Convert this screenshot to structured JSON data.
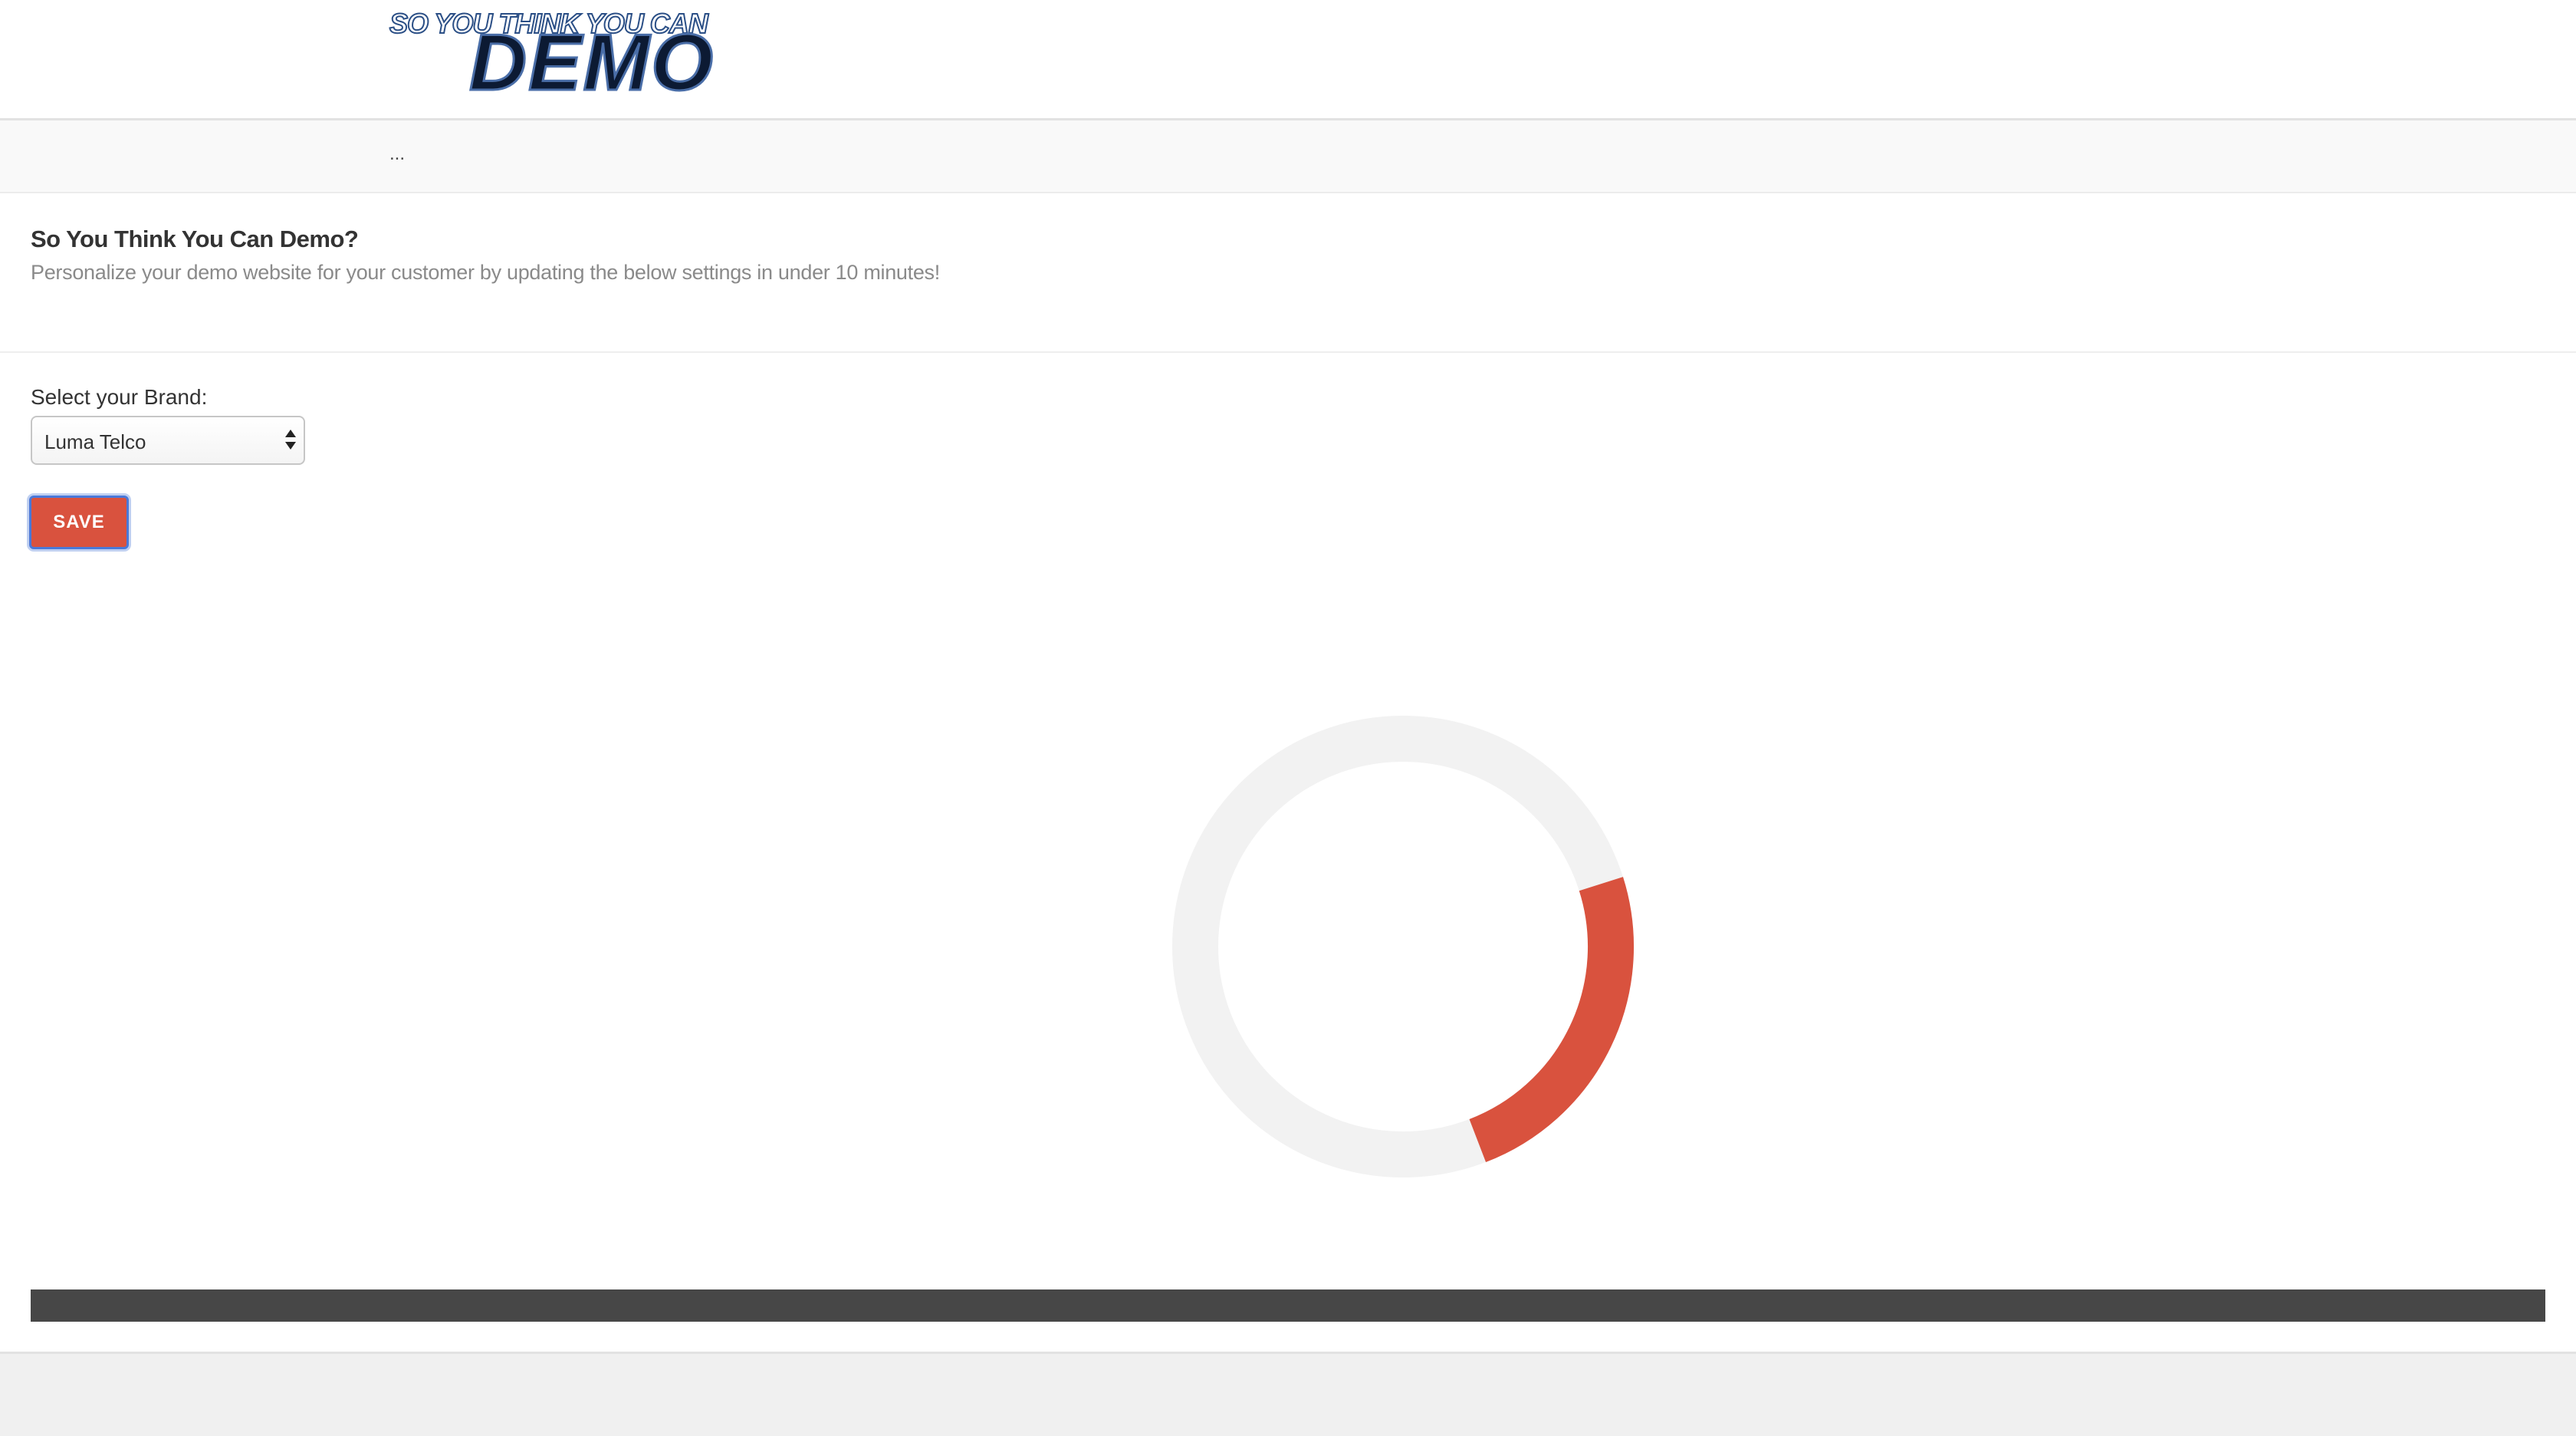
{
  "header": {
    "logo": {
      "line1": "SO YOU THINK YOU CAN",
      "line2": "DEMO"
    }
  },
  "breadcrumb": {
    "text": "..."
  },
  "intro": {
    "title": "So You Think You Can Demo?",
    "subtitle": "Personalize your demo website for your customer by updating the below settings in under 10 minutes!"
  },
  "form": {
    "brand_label": "Select your Brand:",
    "brand_selected": "Luma Telco",
    "save_label": "SAVE"
  },
  "colors": {
    "accent": "#d9523e",
    "spinner_track": "#f2f2f2",
    "progress_bar": "#474747",
    "focus_ring": "#4a78d8"
  },
  "icons": {
    "select": "chevron-up-down-icon",
    "loading": "loading-spinner-icon"
  }
}
